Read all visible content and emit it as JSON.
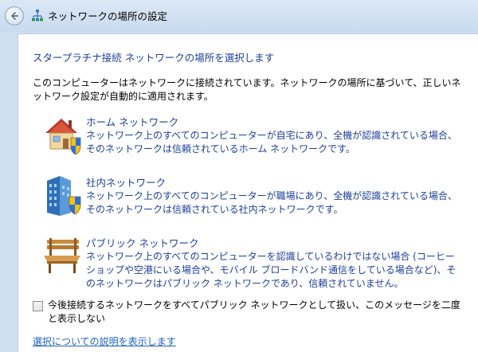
{
  "window": {
    "title": "ネットワークの場所の設定",
    "back_icon": "back-arrow-icon",
    "app_icon": "network-icon"
  },
  "main": {
    "heading": "スタープラチナ接続 ネットワークの場所を選択します",
    "intro": "このコンピューターはネットワークに接続されています。ネットワークの場所に基づいて、正しいネットワーク設定が自動的に適用されます。",
    "options": [
      {
        "title": "ホーム ネットワーク",
        "desc": "ネットワーク上のすべてのコンピューターが自宅にあり、全機が認識されている場合、そのネットワークは信頼されているホーム ネットワークです。",
        "icon": "home-network-icon"
      },
      {
        "title": "社内ネットワーク",
        "desc": "ネットワーク上のすべてのコンピューターが職場にあり、全機が認識されている場合、そのネットワークは信頼されている社内ネットワークです。",
        "icon": "work-network-icon"
      },
      {
        "title": "パブリック ネットワーク",
        "desc": "ネットワーク上のすべてのコンピューターを認識しているわけではない場合 (コーヒーショップや空港にいる場合や、モバイル ブロードバンド通信をしている場合など)、そのネットワークはパブリック ネットワークであり、信頼されていません。",
        "icon": "public-network-icon"
      }
    ],
    "checkbox_label": "今後接続するネットワークをすべてパブリック ネットワークとして扱い、このメッセージを二度と表示しない",
    "checkbox_checked": false,
    "help_link": "選択についての説明を表示します"
  },
  "colors": {
    "link_blue": "#1e3f9a",
    "hyperlink": "#1e60c8",
    "frame": "#cfe0f1"
  }
}
